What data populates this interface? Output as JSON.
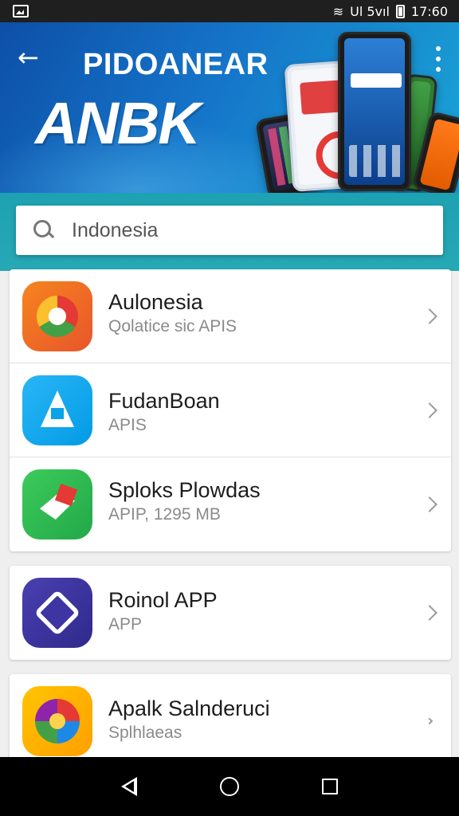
{
  "status_bar": {
    "signal_text": "Ul 5vıl",
    "time": "17:60"
  },
  "header": {
    "title": "PIDOANEAR",
    "logo_text": "ANBK"
  },
  "search": {
    "value": "Indonesia",
    "placeholder": "Indonesia"
  },
  "apps": [
    {
      "name": "Aulonesia",
      "subtitle": "Qolatice sic APIS",
      "icon": "chrome-like-icon",
      "color": "#f6841f"
    },
    {
      "name": "FudanBoan",
      "subtitle": "APIS",
      "icon": "app-store-icon",
      "color": "#29b6f6"
    },
    {
      "name": "Sploks Plowdas",
      "subtitle": "APIP, 1295 MB",
      "icon": "maps-icon",
      "color": "#3ccb5a"
    },
    {
      "name": "Roinol APP",
      "subtitle": "APP",
      "icon": "hexagon-icon",
      "color": "#4a3fb0"
    },
    {
      "name": "Apalk Salnderuci",
      "subtitle": "Splhlaeas",
      "icon": "pinwheel-icon",
      "color": "#ffc400"
    }
  ]
}
